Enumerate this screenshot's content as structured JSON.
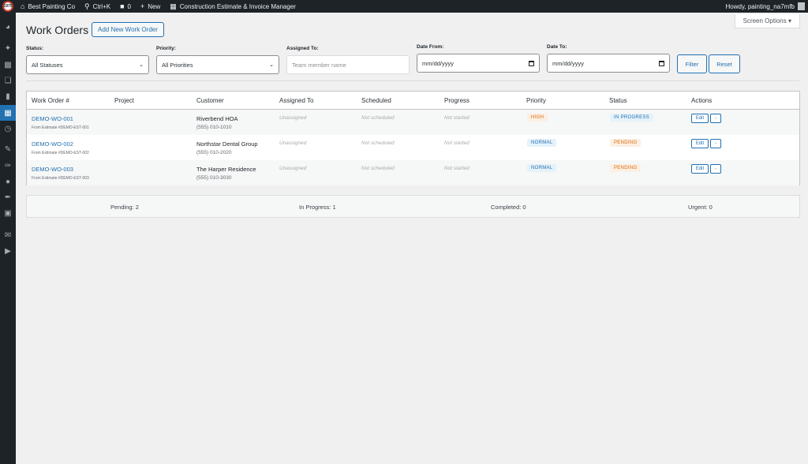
{
  "adminbar": {
    "logo_text": "1975",
    "site_name": "Best Painting Co",
    "search_shortcut": "Ctrl+K",
    "comments_count": "0",
    "new_label": "New",
    "plugin_name": "Construction Estimate & Invoice Manager",
    "howdy": "Howdy, painting_na7mfb"
  },
  "screen_options": "Screen Options ▾",
  "page": {
    "title": "Work Orders",
    "add_new": "Add New Work Order"
  },
  "filters": {
    "status_label": "Status:",
    "status_value": "All Statuses",
    "priority_label": "Priority:",
    "priority_value": "All Priorities",
    "assigned_label": "Assigned To:",
    "assigned_placeholder": "Team member name",
    "date_from_label": "Date From:",
    "date_from_value": "mm/dd/yyyy",
    "date_to_label": "Date To:",
    "date_to_value": "mm/dd/yyyy",
    "filter_button": "Filter",
    "reset_button": "Reset"
  },
  "table": {
    "columns": [
      "Work Order #",
      "Project",
      "Customer",
      "Assigned To",
      "Scheduled",
      "Progress",
      "Priority",
      "Status",
      "Actions"
    ],
    "rows": [
      {
        "wo": "DEMO-WO-001",
        "from": "From Estimate #DEMO-EST-001",
        "customer": "Riverbend HOA",
        "phone": "(555) 010-1010",
        "assigned": "Unassigned",
        "scheduled": "Not scheduled",
        "progress": "Not started",
        "priority": "HIGH",
        "status": "IN PROGRESS",
        "edit": "Edit",
        "more": "-"
      },
      {
        "wo": "DEMO-WO-002",
        "from": "From Estimate #DEMO-EST-002",
        "customer": "Northstar Dental Group",
        "phone": "(555) 010-2020",
        "assigned": "Unassigned",
        "scheduled": "Not scheduled",
        "progress": "Not started",
        "priority": "NORMAL",
        "status": "PENDING",
        "edit": "Edit",
        "more": "-"
      },
      {
        "wo": "DEMO-WO-003",
        "from": "From Estimate #DEMO-EST-003",
        "customer": "The Harper Residence",
        "phone": "(555) 010-3030",
        "assigned": "Unassigned",
        "scheduled": "Not scheduled",
        "progress": "Not started",
        "priority": "NORMAL",
        "status": "PENDING",
        "edit": "Edit",
        "more": "-"
      }
    ]
  },
  "stats": {
    "pending": "Pending: 2",
    "in_progress": "In Progress: 1",
    "completed": "Completed: 0",
    "urgent": "Urgent: 0"
  },
  "colors": {
    "accent": "#2271b1",
    "admin_bar": "#1d2327",
    "background": "#f0f0f1",
    "warning_text": "#d96c0a"
  }
}
